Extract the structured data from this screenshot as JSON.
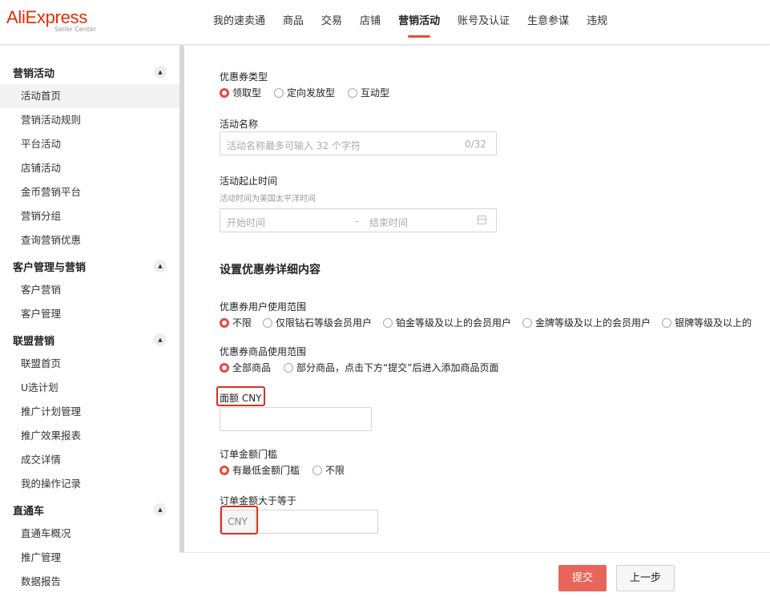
{
  "header": {
    "logo_text": "AliExpress",
    "logo_sub": "Seller Center",
    "nav": [
      "我的速卖通",
      "商品",
      "交易",
      "店铺",
      "营销活动",
      "账号及认证",
      "生意参谋",
      "违规"
    ],
    "active_nav": "营销活动"
  },
  "sidebar": {
    "groups": [
      {
        "title": "营销活动",
        "items": [
          "活动首页",
          "营销活动规则",
          "平台活动",
          "店铺活动",
          "金币营销平台",
          "营销分组",
          "查询营销优惠"
        ]
      },
      {
        "title": "客户管理与营销",
        "items": [
          "客户营销",
          "客户管理"
        ]
      },
      {
        "title": "联盟营销",
        "items": [
          "联盟首页",
          "U选计划",
          "推广计划管理",
          "推广效果报表",
          "成交详情",
          "我的操作记录"
        ]
      },
      {
        "title": "直通车",
        "items": [
          "直通车概况",
          "推广管理",
          "数据报告"
        ]
      }
    ],
    "active_item": "活动首页"
  },
  "form": {
    "coupon_type": {
      "label": "优惠券类型",
      "options": [
        "领取型",
        "定向发放型",
        "互动型"
      ],
      "selected": "领取型"
    },
    "activity_name": {
      "label": "活动名称",
      "placeholder": "活动名称最多可输入 32 个字符",
      "counter": "0/32"
    },
    "activity_time": {
      "label": "活动起止时间",
      "hint": "活动时间为美国太平洋时间",
      "start_placeholder": "开始时间",
      "separator": "-",
      "end_placeholder": "结束时间"
    },
    "section_title": "设置优惠券详细内容",
    "user_scope": {
      "label": "优惠券用户使用范围",
      "options": [
        "不限",
        "仅限钻石等级会员用户",
        "铂金等级及以上的会员用户",
        "金牌等级及以上的会员用户",
        "银牌等级及以上的"
      ],
      "selected": "不限"
    },
    "product_scope": {
      "label": "优惠券商品使用范围",
      "options": [
        "全部商品",
        "部分商品，点击下方“提交”后进入添加商品页面"
      ],
      "selected": "全部商品"
    },
    "face_value": {
      "label": "面额 CNY",
      "value": ""
    },
    "order_threshold": {
      "label": "订单金额门槛",
      "options": [
        "有最低金额门槛",
        "不限"
      ],
      "selected": "有最低金额门槛"
    },
    "order_min": {
      "label": "订单金额大于等于",
      "addon": "CNY",
      "value": ""
    },
    "highlight_color": "#d93026",
    "accent_color": "#e8483f"
  },
  "footer": {
    "submit_label": "提交",
    "back_label": "上一步"
  }
}
